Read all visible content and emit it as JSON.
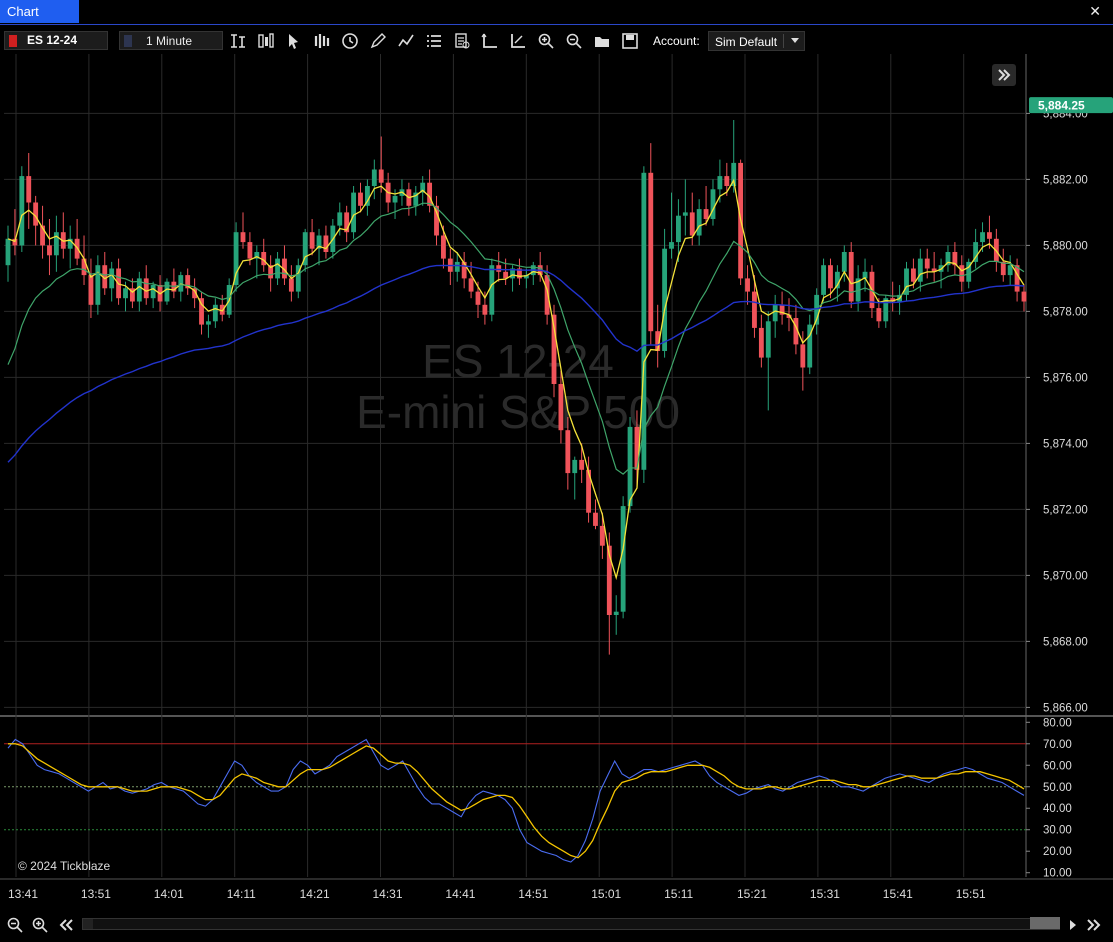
{
  "window": {
    "tab_title": "Chart",
    "close_label": "✕"
  },
  "toolbar": {
    "symbol": "ES 12-24",
    "timeframe": "1 Minute",
    "account_label": "Account:",
    "account_value": "Sim Default",
    "icons": [
      "bar-type-icon",
      "candle-type-icon",
      "cursor-icon",
      "bars-icon",
      "clock-icon",
      "pencil-icon",
      "line-drawing-icon",
      "list-icon",
      "data-box-icon",
      "axis-icon",
      "axis-alt-icon",
      "zoom-in-icon",
      "zoom-out-icon",
      "folder-icon",
      "save-icon"
    ]
  },
  "colors": {
    "up": "#26a37a",
    "down": "#f0535a",
    "ema_fast": "#f4e23a",
    "ema_mid": "#3fa56a",
    "ema_slow": "#2233cc",
    "osc_blue": "#4a6cf0",
    "osc_yellow": "#f4c400",
    "overbought": "#b02020",
    "oversold": "#2a8a3a",
    "price_tag": "#26a37a",
    "grid": "#2a2a2a"
  },
  "watermark": {
    "line1": "ES 12-24",
    "line2": "E-mini S&P 500"
  },
  "copyright": "© 2024 Tickblaze",
  "last_price": "5,884.25",
  "chart_data": {
    "type": "candlestick",
    "symbol": "ES 12-24",
    "interval": "1 Minute",
    "price_axis": {
      "ticks": [
        "5,884.00",
        "5,882.00",
        "5,880.00",
        "5,878.00",
        "5,876.00",
        "5,874.00",
        "5,872.00",
        "5,870.00",
        "5,868.00",
        "5,866.00"
      ],
      "range": [
        5865.8,
        5885.8
      ]
    },
    "oscillator_axis": {
      "ticks": [
        "80.00",
        "70.00",
        "60.00",
        "50.00",
        "40.00",
        "30.00",
        "20.00",
        "10.00"
      ],
      "range": [
        8,
        82
      ],
      "levels": [
        70,
        50,
        30
      ]
    },
    "time_axis": {
      "ticks": [
        "13:41",
        "13:51",
        "14:01",
        "14:11",
        "14:21",
        "14:31",
        "14:41",
        "14:51",
        "15:01",
        "15:11",
        "15:21",
        "15:31",
        "15:41",
        "15:51"
      ]
    },
    "candles": [
      [
        5879.4,
        5880.6,
        5878.9,
        5880.2
      ],
      [
        5880.2,
        5881.1,
        5879.7,
        5880.0
      ],
      [
        5880.0,
        5882.4,
        5879.8,
        5882.1
      ],
      [
        5882.1,
        5882.8,
        5880.5,
        5881.3
      ],
      [
        5881.3,
        5881.5,
        5880.0,
        5880.6
      ],
      [
        5880.6,
        5881.2,
        5879.6,
        5880.0
      ],
      [
        5880.0,
        5880.8,
        5879.1,
        5879.7
      ],
      [
        5879.7,
        5880.9,
        5879.2,
        5880.4
      ],
      [
        5880.4,
        5881.0,
        5879.6,
        5879.9
      ],
      [
        5879.9,
        5880.6,
        5879.3,
        5880.2
      ],
      [
        5880.2,
        5880.8,
        5879.4,
        5879.6
      ],
      [
        5879.6,
        5880.3,
        5878.8,
        5879.1
      ],
      [
        5879.1,
        5879.6,
        5877.8,
        5878.2
      ],
      [
        5878.2,
        5879.7,
        5877.9,
        5879.4
      ],
      [
        5879.4,
        5879.8,
        5878.5,
        5878.7
      ],
      [
        5878.7,
        5879.5,
        5878.3,
        5879.3
      ],
      [
        5879.3,
        5879.6,
        5878.2,
        5878.4
      ],
      [
        5878.4,
        5878.9,
        5878.0,
        5878.7
      ],
      [
        5878.7,
        5879.0,
        5878.1,
        5878.3
      ],
      [
        5878.3,
        5879.2,
        5878.0,
        5879.0
      ],
      [
        5879.0,
        5879.4,
        5878.2,
        5878.4
      ],
      [
        5878.4,
        5878.9,
        5878.1,
        5878.8
      ],
      [
        5878.8,
        5879.1,
        5878.0,
        5878.3
      ],
      [
        5878.3,
        5879.0,
        5878.2,
        5878.9
      ],
      [
        5878.9,
        5879.3,
        5878.4,
        5878.6
      ],
      [
        5878.6,
        5879.2,
        5878.3,
        5879.1
      ],
      [
        5879.1,
        5879.3,
        5878.5,
        5878.7
      ],
      [
        5878.7,
        5879.0,
        5878.1,
        5878.4
      ],
      [
        5878.4,
        5878.6,
        5877.3,
        5877.6
      ],
      [
        5877.6,
        5877.9,
        5877.2,
        5877.7
      ],
      [
        5877.7,
        5878.4,
        5877.5,
        5878.2
      ],
      [
        5878.2,
        5878.5,
        5877.7,
        5877.9
      ],
      [
        5877.9,
        5879.0,
        5877.8,
        5878.8
      ],
      [
        5878.8,
        5880.7,
        5878.6,
        5880.4
      ],
      [
        5880.4,
        5881.0,
        5879.9,
        5880.1
      ],
      [
        5880.1,
        5880.4,
        5879.4,
        5879.6
      ],
      [
        5879.6,
        5880.0,
        5879.0,
        5879.8
      ],
      [
        5879.8,
        5880.2,
        5879.2,
        5879.4
      ],
      [
        5879.4,
        5879.7,
        5878.6,
        5879.0
      ],
      [
        5879.0,
        5879.8,
        5878.8,
        5879.6
      ],
      [
        5879.6,
        5880.0,
        5878.8,
        5879.0
      ],
      [
        5879.0,
        5879.4,
        5878.3,
        5878.6
      ],
      [
        5878.6,
        5879.6,
        5878.4,
        5879.4
      ],
      [
        5879.4,
        5880.5,
        5879.2,
        5880.4
      ],
      [
        5880.4,
        5880.8,
        5879.7,
        5879.9
      ],
      [
        5879.9,
        5880.5,
        5879.4,
        5880.3
      ],
      [
        5880.3,
        5880.6,
        5879.6,
        5879.8
      ],
      [
        5879.8,
        5880.8,
        5879.6,
        5880.6
      ],
      [
        5880.6,
        5881.3,
        5880.3,
        5881.0
      ],
      [
        5881.0,
        5881.2,
        5880.1,
        5880.4
      ],
      [
        5880.4,
        5881.8,
        5880.2,
        5881.6
      ],
      [
        5881.6,
        5881.9,
        5881.0,
        5881.2
      ],
      [
        5881.2,
        5882.0,
        5880.9,
        5881.8
      ],
      [
        5881.8,
        5882.6,
        5881.4,
        5882.3
      ],
      [
        5882.3,
        5883.3,
        5881.6,
        5881.9
      ],
      [
        5881.9,
        5882.2,
        5881.0,
        5881.3
      ],
      [
        5881.3,
        5881.7,
        5880.8,
        5881.5
      ],
      [
        5881.5,
        5882.0,
        5881.2,
        5881.7
      ],
      [
        5881.7,
        5881.9,
        5880.9,
        5881.2
      ],
      [
        5881.2,
        5881.8,
        5880.9,
        5881.6
      ],
      [
        5881.6,
        5882.1,
        5881.2,
        5881.9
      ],
      [
        5881.9,
        5882.3,
        5881.0,
        5881.2
      ],
      [
        5881.2,
        5881.5,
        5880.0,
        5880.3
      ],
      [
        5880.3,
        5880.6,
        5879.3,
        5879.6
      ],
      [
        5879.6,
        5879.9,
        5878.8,
        5879.2
      ],
      [
        5879.2,
        5879.8,
        5878.9,
        5879.5
      ],
      [
        5879.5,
        5879.8,
        5878.7,
        5879.0
      ],
      [
        5879.0,
        5879.5,
        5878.4,
        5878.6
      ],
      [
        5878.6,
        5878.9,
        5877.8,
        5878.2
      ],
      [
        5878.2,
        5878.6,
        5877.6,
        5877.9
      ],
      [
        5877.9,
        5879.6,
        5877.7,
        5879.4
      ],
      [
        5879.4,
        5879.8,
        5878.9,
        5879.2
      ],
      [
        5879.2,
        5879.6,
        5878.8,
        5879.0
      ],
      [
        5879.0,
        5879.4,
        5878.6,
        5879.3
      ],
      [
        5879.3,
        5879.6,
        5878.8,
        5879.0
      ],
      [
        5879.0,
        5879.3,
        5878.7,
        5879.1
      ],
      [
        5879.1,
        5879.5,
        5878.8,
        5879.4
      ],
      [
        5879.4,
        5879.8,
        5878.9,
        5879.1
      ],
      [
        5879.1,
        5879.4,
        5877.6,
        5877.9
      ],
      [
        5877.9,
        5878.2,
        5875.4,
        5875.8
      ],
      [
        5875.8,
        5876.2,
        5874.0,
        5874.4
      ],
      [
        5874.4,
        5874.8,
        5872.6,
        5873.1
      ],
      [
        5873.1,
        5873.6,
        5872.3,
        5873.5
      ],
      [
        5873.5,
        5874.0,
        5872.8,
        5873.2
      ],
      [
        5873.2,
        5873.6,
        5871.6,
        5871.9
      ],
      [
        5871.9,
        5872.3,
        5871.4,
        5871.5
      ],
      [
        5871.5,
        5871.9,
        5870.5,
        5870.9
      ],
      [
        5870.9,
        5871.3,
        5867.6,
        5868.8
      ],
      [
        5868.8,
        5869.4,
        5868.2,
        5868.9
      ],
      [
        5868.9,
        5872.4,
        5868.7,
        5872.1
      ],
      [
        5872.1,
        5874.8,
        5871.9,
        5874.5
      ],
      [
        5874.5,
        5875.0,
        5872.7,
        5873.2
      ],
      [
        5873.2,
        5882.4,
        5872.8,
        5882.2
      ],
      [
        5882.2,
        5883.1,
        5877.0,
        5877.4
      ],
      [
        5877.4,
        5878.2,
        5876.3,
        5876.8
      ],
      [
        5876.8,
        5880.5,
        5876.6,
        5879.9
      ],
      [
        5879.9,
        5881.6,
        5879.6,
        5880.1
      ],
      [
        5880.1,
        5881.4,
        5879.5,
        5880.9
      ],
      [
        5880.9,
        5882.0,
        5880.3,
        5881.0
      ],
      [
        5881.0,
        5881.6,
        5880.0,
        5880.3
      ],
      [
        5880.3,
        5881.4,
        5880.0,
        5881.1
      ],
      [
        5881.1,
        5881.8,
        5880.6,
        5880.8
      ],
      [
        5880.8,
        5882.0,
        5880.6,
        5881.7
      ],
      [
        5881.7,
        5882.6,
        5881.3,
        5882.1
      ],
      [
        5882.1,
        5882.5,
        5881.5,
        5881.8
      ],
      [
        5881.8,
        5883.8,
        5881.6,
        5882.5
      ],
      [
        5882.5,
        5882.6,
        5878.8,
        5879.0
      ],
      [
        5879.0,
        5879.4,
        5878.2,
        5878.6
      ],
      [
        5878.6,
        5879.1,
        5877.2,
        5877.5
      ],
      [
        5877.5,
        5877.9,
        5876.3,
        5876.6
      ],
      [
        5876.6,
        5878.0,
        5875.0,
        5877.7
      ],
      [
        5877.7,
        5878.5,
        5877.2,
        5878.2
      ],
      [
        5878.2,
        5878.6,
        5877.6,
        5877.9
      ],
      [
        5877.9,
        5878.4,
        5877.4,
        5877.8
      ],
      [
        5877.8,
        5878.2,
        5876.7,
        5877.0
      ],
      [
        5877.0,
        5877.4,
        5875.6,
        5876.3
      ],
      [
        5876.3,
        5877.9,
        5876.1,
        5877.6
      ],
      [
        5877.6,
        5878.7,
        5877.3,
        5878.5
      ],
      [
        5878.5,
        5879.6,
        5878.3,
        5879.4
      ],
      [
        5879.4,
        5879.6,
        5878.4,
        5878.7
      ],
      [
        5878.7,
        5879.4,
        5878.3,
        5879.2
      ],
      [
        5879.2,
        5880.0,
        5878.9,
        5879.8
      ],
      [
        5879.8,
        5880.1,
        5878.1,
        5878.3
      ],
      [
        5878.3,
        5879.4,
        5878.0,
        5879.0
      ],
      [
        5879.0,
        5879.6,
        5878.6,
        5879.2
      ],
      [
        5879.2,
        5879.4,
        5877.8,
        5878.1
      ],
      [
        5878.1,
        5878.4,
        5877.5,
        5877.7
      ],
      [
        5877.7,
        5878.5,
        5877.5,
        5878.4
      ],
      [
        5878.4,
        5878.9,
        5878.0,
        5878.3
      ],
      [
        5878.3,
        5878.8,
        5877.9,
        5878.5
      ],
      [
        5878.5,
        5879.5,
        5878.3,
        5879.3
      ],
      [
        5879.3,
        5879.6,
        5878.7,
        5878.9
      ],
      [
        5878.9,
        5879.9,
        5878.6,
        5879.6
      ],
      [
        5879.6,
        5879.9,
        5879.0,
        5879.3
      ],
      [
        5879.3,
        5879.8,
        5878.9,
        5879.2
      ],
      [
        5879.2,
        5879.6,
        5878.7,
        5879.4
      ],
      [
        5879.4,
        5880.0,
        5879.2,
        5879.8
      ],
      [
        5879.8,
        5880.1,
        5879.1,
        5879.4
      ],
      [
        5879.4,
        5879.7,
        5878.6,
        5878.9
      ],
      [
        5878.9,
        5879.6,
        5878.7,
        5879.5
      ],
      [
        5879.5,
        5880.5,
        5879.3,
        5880.1
      ],
      [
        5880.1,
        5880.7,
        5879.8,
        5880.4
      ],
      [
        5880.4,
        5880.9,
        5879.9,
        5880.2
      ],
      [
        5880.2,
        5880.5,
        5879.2,
        5879.5
      ],
      [
        5879.5,
        5879.9,
        5878.9,
        5879.1
      ],
      [
        5879.1,
        5879.7,
        5878.8,
        5879.4
      ],
      [
        5879.4,
        5879.6,
        5878.3,
        5878.6
      ],
      [
        5878.6,
        5878.8,
        5878.0,
        5878.3
      ]
    ],
    "oscillator": {
      "blue": [
        68,
        72,
        70,
        65,
        60,
        58,
        57,
        56,
        54,
        52,
        50,
        48,
        50,
        52,
        49,
        50,
        48,
        47,
        48,
        49,
        51,
        52,
        50,
        49,
        48,
        45,
        42,
        41,
        44,
        50,
        56,
        62,
        60,
        55,
        52,
        50,
        48,
        48,
        50,
        58,
        62,
        60,
        56,
        58,
        60,
        64,
        66,
        68,
        70,
        72,
        66,
        60,
        58,
        60,
        62,
        56,
        50,
        45,
        42,
        42,
        40,
        38,
        36,
        42,
        46,
        48,
        47,
        46,
        44,
        40,
        30,
        24,
        22,
        20,
        19,
        18,
        16,
        15,
        18,
        25,
        35,
        48,
        55,
        62,
        56,
        54,
        56,
        58,
        58,
        57,
        58,
        59,
        60,
        61,
        62,
        60,
        55,
        52,
        50,
        48,
        46,
        47,
        49,
        50,
        51,
        49,
        48,
        50,
        52,
        53,
        54,
        55,
        54,
        52,
        50,
        50,
        49,
        48,
        50,
        52,
        54,
        55,
        56,
        55,
        54,
        53,
        52,
        54,
        56,
        57,
        58,
        59,
        58,
        56,
        54,
        53,
        52,
        50,
        48,
        46
      ],
      "yellow": [
        70,
        70,
        69,
        66,
        63,
        61,
        59,
        57,
        55,
        53,
        51,
        50,
        50,
        50,
        50,
        50,
        49,
        48,
        48,
        48,
        49,
        50,
        50,
        50,
        49,
        48,
        46,
        44,
        44,
        46,
        50,
        54,
        56,
        55,
        54,
        52,
        51,
        50,
        50,
        53,
        56,
        58,
        58,
        58,
        59,
        61,
        63,
        65,
        67,
        69,
        68,
        65,
        62,
        61,
        61,
        60,
        57,
        53,
        49,
        46,
        43,
        41,
        39,
        40,
        42,
        44,
        45,
        46,
        46,
        45,
        41,
        36,
        31,
        27,
        24,
        22,
        20,
        18,
        17,
        20,
        25,
        33,
        40,
        48,
        52,
        53,
        54,
        56,
        57,
        57,
        57,
        58,
        59,
        60,
        60,
        60,
        59,
        57,
        55,
        52,
        50,
        49,
        49,
        49,
        50,
        50,
        49,
        49,
        50,
        51,
        52,
        53,
        53,
        53,
        52,
        51,
        51,
        50,
        50,
        51,
        52,
        53,
        54,
        55,
        55,
        54,
        54,
        54,
        55,
        56,
        56,
        57,
        57,
        57,
        56,
        55,
        54,
        53,
        51,
        49
      ]
    }
  }
}
